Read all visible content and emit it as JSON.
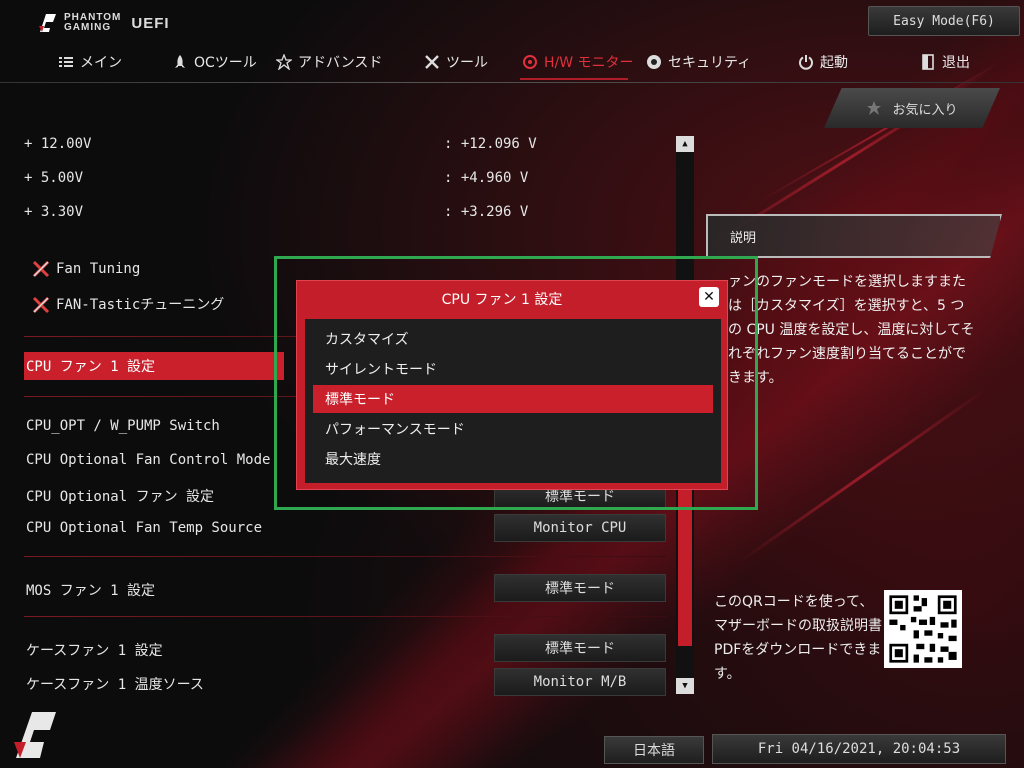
{
  "header": {
    "brand_line1": "PHANTOM",
    "brand_line2": "GAMING",
    "uefi": "UEFI",
    "easy_mode": "Easy Mode(F6)"
  },
  "nav": [
    {
      "label": "メイン",
      "icon": "list-icon"
    },
    {
      "label": "OCツール",
      "icon": "rocket-icon"
    },
    {
      "label": "アドバンスド",
      "icon": "star-icon"
    },
    {
      "label": "ツール",
      "icon": "tools-icon"
    },
    {
      "label": "H/W モニター",
      "icon": "monitor-gauge-icon",
      "active": true
    },
    {
      "label": "セキュリティ",
      "icon": "shield-icon"
    },
    {
      "label": "起動",
      "icon": "power-icon"
    },
    {
      "label": "退出",
      "icon": "exit-icon"
    }
  ],
  "favorites": {
    "label": "お気に入り",
    "icon": "star-icon"
  },
  "voltages": [
    {
      "label": "+ 12.00V",
      "value": ": +12.096 V"
    },
    {
      "label": "+ 5.00V",
      "value": ": +4.960 V"
    },
    {
      "label": "+ 3.30V",
      "value": ": +3.296 V"
    }
  ],
  "links": {
    "fan_tuning": "Fan Tuning",
    "fan_tastic": "FAN-Tasticチューニング"
  },
  "settings": {
    "cpu_fan1": "CPU ファン 1 設定",
    "cpu_opt_switch": "CPU_OPT / W_PUMP Switch",
    "cpu_opt_control_mode": "CPU Optional Fan Control Mode",
    "cpu_opt_fan_setting": "CPU Optional ファン 設定",
    "cpu_opt_fan_setting_value": "標準モード",
    "cpu_opt_temp_source": "CPU Optional Fan Temp Source",
    "cpu_opt_temp_source_value": "Monitor CPU",
    "mos_fan1": "MOS ファン 1 設定",
    "mos_fan1_value": "標準モード",
    "case_fan1": "ケースファン 1 設定",
    "case_fan1_value": "標準モード",
    "case_fan1_temp": "ケースファン 1 温度ソース",
    "case_fan1_temp_value": "Monitor M/B"
  },
  "description": {
    "title": "説明",
    "text": "ファンのファンモードを選択します。または［カスタマイズ］を選択すると、5 つの CPU 温度を設定し、温度に対してそれぞれファン速度を割り当てることができます。",
    "visible_text": "ァンのファンモードを選択しますまたは［カスタマイズ］を選択すと、5 つの CPU 温度を設定し、温度に対してそれぞれファン速度割り当てることができます。"
  },
  "qr": {
    "text": "このQRコードを使って、マザーボードの取扱説明書PDFをダウンロードできます。"
  },
  "footer": {
    "language": "日本語",
    "datetime": "Fri 04/16/2021, 20:04:53"
  },
  "popup": {
    "title": "CPU ファン 1 設定",
    "close": "✕",
    "options": [
      "カスタマイズ",
      "サイレントモード",
      "標準モード",
      "パフォーマンスモード",
      "最大速度"
    ],
    "selected_index": 2
  },
  "scroll": {
    "up": "▲",
    "down": "▼"
  },
  "colors": {
    "accent": "#c9202c",
    "highlight_frame": "#2fa84f"
  }
}
